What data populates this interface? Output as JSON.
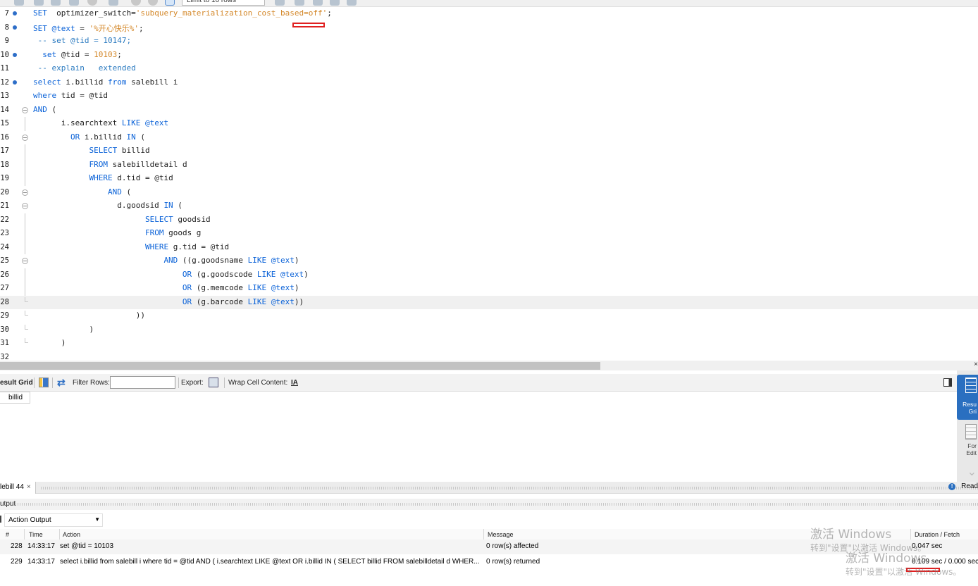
{
  "toolbar": {
    "limit_label": "Limit to 10 rows"
  },
  "editor": {
    "lines": [
      {
        "num": "7",
        "dot": true,
        "fold": "",
        "tokens": [
          [
            "kw",
            "SET"
          ],
          [
            "",
            "  optimizer_switch="
          ],
          [
            "str",
            "'subquery_materialization_cost_based=off'"
          ],
          [
            "",
            ";"
          ]
        ]
      },
      {
        "num": "8",
        "dot": true,
        "fold": "",
        "tokens": [
          [
            "kw",
            "SET"
          ],
          [
            "",
            " "
          ],
          [
            "var",
            "@text"
          ],
          [
            "",
            " = "
          ],
          [
            "str",
            "'%开心快乐%'"
          ],
          [
            "",
            ";"
          ]
        ]
      },
      {
        "num": "9",
        "dot": false,
        "fold": "",
        "tokens": [
          [
            "cmt",
            " -- set @tid = 10147;"
          ]
        ]
      },
      {
        "num": "10",
        "dot": true,
        "fold": "",
        "tokens": [
          [
            "",
            ""
          ],
          [
            "kw",
            "  set"
          ],
          [
            "",
            " @tid = "
          ],
          [
            "str",
            "10103"
          ],
          [
            "",
            ";"
          ]
        ]
      },
      {
        "num": "11",
        "dot": false,
        "fold": "",
        "tokens": [
          [
            "cmt",
            " -- explain   extended"
          ]
        ]
      },
      {
        "num": "12",
        "dot": true,
        "fold": "",
        "tokens": [
          [
            "kw",
            "select"
          ],
          [
            "",
            " i.billid "
          ],
          [
            "kw",
            "from"
          ],
          [
            "",
            " salebill i"
          ]
        ]
      },
      {
        "num": "13",
        "dot": false,
        "fold": "",
        "tokens": [
          [
            "kw",
            "where"
          ],
          [
            "",
            " tid = @tid"
          ]
        ]
      },
      {
        "num": "14",
        "dot": false,
        "fold": "open",
        "tokens": [
          [
            "kw",
            "AND"
          ],
          [
            "",
            " ("
          ]
        ]
      },
      {
        "num": "15",
        "dot": false,
        "fold": "line",
        "tokens": [
          [
            "",
            "      i.searchtext "
          ],
          [
            "kw",
            "LIKE"
          ],
          [
            "",
            " "
          ],
          [
            "var",
            "@text"
          ]
        ]
      },
      {
        "num": "16",
        "dot": false,
        "fold": "open",
        "tokens": [
          [
            "",
            "        "
          ],
          [
            "kw",
            "OR"
          ],
          [
            "",
            " i.billid "
          ],
          [
            "kw",
            "IN"
          ],
          [
            "",
            " ("
          ]
        ]
      },
      {
        "num": "17",
        "dot": false,
        "fold": "line",
        "tokens": [
          [
            "",
            "            "
          ],
          [
            "kw",
            "SELECT"
          ],
          [
            "",
            " billid"
          ]
        ]
      },
      {
        "num": "18",
        "dot": false,
        "fold": "line",
        "tokens": [
          [
            "",
            "            "
          ],
          [
            "kw",
            "FROM"
          ],
          [
            "",
            " salebilldetail d"
          ]
        ]
      },
      {
        "num": "19",
        "dot": false,
        "fold": "line",
        "tokens": [
          [
            "",
            "            "
          ],
          [
            "kw",
            "WHERE"
          ],
          [
            "",
            " d.tid = @tid"
          ]
        ]
      },
      {
        "num": "20",
        "dot": false,
        "fold": "open",
        "tokens": [
          [
            "",
            "                "
          ],
          [
            "kw",
            "AND"
          ],
          [
            "",
            " ("
          ]
        ]
      },
      {
        "num": "21",
        "dot": false,
        "fold": "open",
        "tokens": [
          [
            "",
            "                  d.goodsid "
          ],
          [
            "kw",
            "IN"
          ],
          [
            "",
            " ("
          ]
        ]
      },
      {
        "num": "22",
        "dot": false,
        "fold": "line",
        "tokens": [
          [
            "",
            "                        "
          ],
          [
            "kw",
            "SELECT"
          ],
          [
            "",
            " goodsid"
          ]
        ]
      },
      {
        "num": "23",
        "dot": false,
        "fold": "line",
        "tokens": [
          [
            "",
            "                        "
          ],
          [
            "kw",
            "FROM"
          ],
          [
            "",
            " goods g"
          ]
        ]
      },
      {
        "num": "24",
        "dot": false,
        "fold": "line",
        "tokens": [
          [
            "",
            "                        "
          ],
          [
            "kw",
            "WHERE"
          ],
          [
            "",
            " g.tid = @tid"
          ]
        ]
      },
      {
        "num": "25",
        "dot": false,
        "fold": "open",
        "tokens": [
          [
            "",
            "                            "
          ],
          [
            "kw",
            "AND"
          ],
          [
            "",
            " ((g.goodsname "
          ],
          [
            "kw",
            "LIKE"
          ],
          [
            "",
            " "
          ],
          [
            "var",
            "@text"
          ],
          [
            "",
            ")"
          ]
        ]
      },
      {
        "num": "26",
        "dot": false,
        "fold": "line",
        "tokens": [
          [
            "",
            "                                "
          ],
          [
            "kw",
            "OR"
          ],
          [
            "",
            " (g.goodscode "
          ],
          [
            "kw",
            "LIKE"
          ],
          [
            "",
            " "
          ],
          [
            "var",
            "@text"
          ],
          [
            "",
            ")"
          ]
        ]
      },
      {
        "num": "27",
        "dot": false,
        "fold": "line",
        "tokens": [
          [
            "",
            "                                "
          ],
          [
            "kw",
            "OR"
          ],
          [
            "",
            " (g.memcode "
          ],
          [
            "kw",
            "LIKE"
          ],
          [
            "",
            " "
          ],
          [
            "var",
            "@text"
          ],
          [
            "",
            ")"
          ]
        ]
      },
      {
        "num": "28",
        "dot": false,
        "fold": "end",
        "current": true,
        "tokens": [
          [
            "",
            "                                "
          ],
          [
            "kw",
            "OR"
          ],
          [
            "",
            " (g.barcode "
          ],
          [
            "kw",
            "LIKE"
          ],
          [
            "",
            " "
          ],
          [
            "var",
            "@text"
          ],
          [
            "",
            "))"
          ]
        ]
      },
      {
        "num": "29",
        "dot": false,
        "fold": "end",
        "tokens": [
          [
            "",
            "                      ))"
          ]
        ]
      },
      {
        "num": "30",
        "dot": false,
        "fold": "end",
        "tokens": [
          [
            "",
            "            )"
          ]
        ]
      },
      {
        "num": "31",
        "dot": false,
        "fold": "end",
        "tokens": [
          [
            "",
            "      )"
          ]
        ]
      },
      {
        "num": "32",
        "dot": false,
        "fold": "",
        "tokens": []
      }
    ]
  },
  "result_toolbar": {
    "result_grid": "esult Grid",
    "filter_rows": "Filter Rows:",
    "export": "Export:",
    "wrap_cell": "Wrap Cell Content:",
    "wrap_icon": "IA"
  },
  "result_grid": {
    "columns": [
      "billid"
    ]
  },
  "side_panel": {
    "result_grid_l1": "Resu",
    "result_grid_l2": "Gri",
    "form_editor_l1": "For",
    "form_editor_l2": "Edit"
  },
  "tabs": {
    "active_tab": "lebill 44",
    "close": "×",
    "read_only": "Read"
  },
  "output": {
    "header": "utput",
    "select_value": "Action Output",
    "columns": {
      "num": "#",
      "time": "Time",
      "action": "Action",
      "message": "Message",
      "duration": "Duration / Fetch"
    },
    "rows": [
      {
        "num": "228",
        "time": "14:33:17",
        "action": "set @tid = 10103",
        "message": "0 row(s) affected",
        "duration": "0.047 sec"
      },
      {
        "num": "229",
        "time": "14:33:17",
        "action": "select i.billid from  salebill i where tid = @tid   AND (   i.searchtext LIKE @text OR i.billid IN ( SELECT billid FROM salebilldetail d WHER...",
        "message": "0 row(s) returned",
        "duration": "0.109 sec / 0.000 sec"
      }
    ]
  },
  "watermark": {
    "line1": "激活 Windows",
    "line2": "转到\"设置\"以激活 Windows。",
    "line3": "激活 Windows",
    "line4": "转到\"设置\"以激活 Windows。"
  },
  "colors": {
    "keyword": "#0a62d8",
    "string": "#d4882a",
    "accent": "#2a6fc0",
    "marker": "#e02020"
  }
}
